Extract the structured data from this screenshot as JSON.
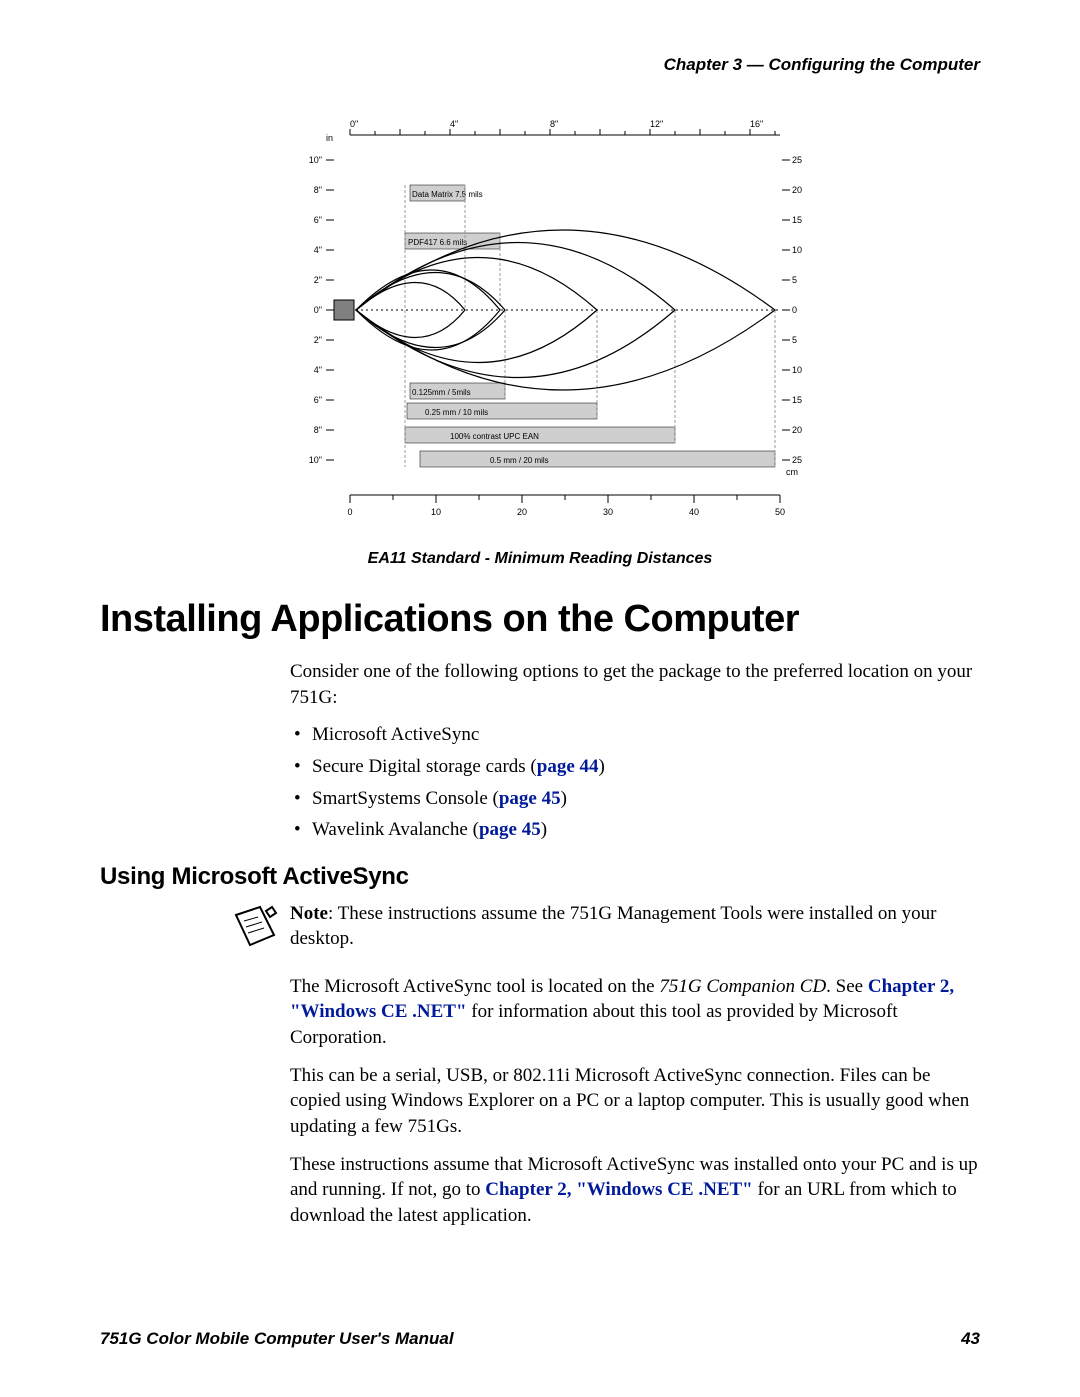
{
  "header": {
    "chapter": "Chapter 3 — Configuring the Computer"
  },
  "chart_data": {
    "type": "diagram",
    "title": "EA11 Standard - Minimum Reading Distances",
    "top_axis": {
      "unit": "in",
      "ticks": [
        "0\"",
        "4\"",
        "8\"",
        "12\"",
        "16\""
      ]
    },
    "left_axis": {
      "unit": "in",
      "ticks": [
        "10\"",
        "8\"",
        "6\"",
        "4\"",
        "2\"",
        "0\"",
        "2\"",
        "4\"",
        "6\"",
        "8\"",
        "10\""
      ]
    },
    "right_axis": {
      "unit": "cm",
      "ticks": [
        "25",
        "20",
        "15",
        "10",
        "5",
        "0",
        "5",
        "10",
        "15",
        "20",
        "25"
      ]
    },
    "bottom_axis": {
      "unit": "cm",
      "ticks": [
        "0",
        "10",
        "20",
        "30",
        "40",
        "50"
      ]
    },
    "bars": [
      {
        "label": "Data Matrix 7.5 mils",
        "start_in": 2.4,
        "end_in": 4.6
      },
      {
        "label": "PDF417 6.6 mils",
        "start_in": 2.2,
        "end_in": 6.0
      },
      {
        "label": "0.125mm / 5mils",
        "start_in": 2.4,
        "end_in": 6.2
      },
      {
        "label": "0.25 mm / 10 mils",
        "start_in": 2.3,
        "end_in": 10.0
      },
      {
        "label": "100% contrast UPC EAN",
        "start_in": 2.2,
        "end_in": 13.2
      },
      {
        "label": "0.5 mm / 20 mils",
        "start_in": 2.8,
        "end_in": 16.8
      }
    ]
  },
  "section": {
    "title": "Installing Applications on the Computer",
    "intro": "Consider one of the following options to get the package to the preferred location on your 751G:",
    "bullets": [
      {
        "text": "Microsoft ActiveSync",
        "link": ""
      },
      {
        "text": "Secure Digital storage cards (",
        "link": "page 44",
        "after": ")"
      },
      {
        "text": "SmartSystems Console (",
        "link": "page 45",
        "after": ")"
      },
      {
        "text": "Wavelink Avalanche (",
        "link": "page 45",
        "after": ")"
      }
    ]
  },
  "subsection": {
    "title": "Using Microsoft ActiveSync",
    "note_label": "Note",
    "note_text": ": These instructions assume the 751G Management Tools were installed on your desktop.",
    "p1_a": "The Microsoft ActiveSync tool is located on the ",
    "p1_i": "751G Companion CD",
    "p1_b": ". See ",
    "p1_link": "Chapter 2, \"Windows CE .NET\"",
    "p1_c": " for information about this tool as provided by Microsoft Corporation.",
    "p2": "This can be a serial, USB, or 802.11i Microsoft ActiveSync connection. Files can be copied using Windows Explorer on a PC or a laptop computer. This is usually good when updating a few 751Gs.",
    "p3_a": "These instructions assume that Microsoft ActiveSync was installed onto your PC and is up and running. If not, go to ",
    "p3_link": "Chapter 2, \"Windows CE .NET\"",
    "p3_b": " for an URL from which to download the latest application."
  },
  "footer": {
    "manual": "751G Color Mobile Computer User's Manual",
    "page": "43"
  }
}
